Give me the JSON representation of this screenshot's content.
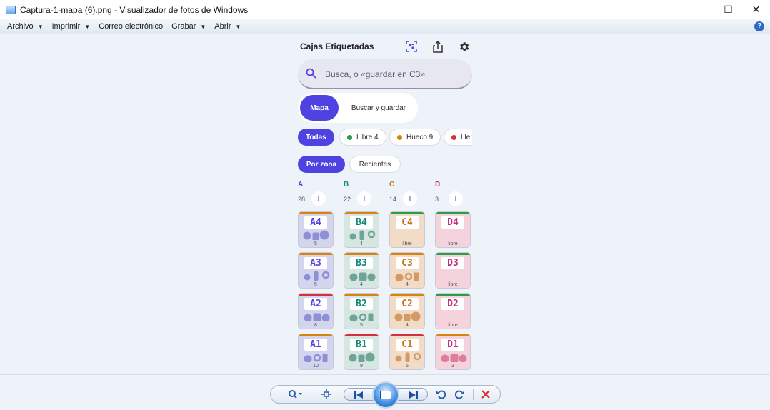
{
  "window": {
    "title": "Captura-1-mapa (6).png - Visualizador de fotos de Windows",
    "minimize": "—",
    "maximize": "☐",
    "close": "✕"
  },
  "menu": [
    "Archivo",
    "Imprimir",
    "Correo electrónico",
    "Grabar",
    "Abrir"
  ],
  "help_label": "?",
  "app": {
    "title": "Cajas Etiquetadas",
    "search_placeholder": "Busca, o «guardar en C3»",
    "segments": [
      "Mapa",
      "Buscar y guardar"
    ],
    "filters": [
      {
        "label": "Todas",
        "selected": true
      },
      {
        "label": "Libre 4",
        "color": "#2e9b45"
      },
      {
        "label": "Hueco 9",
        "color": "#d9820d"
      },
      {
        "label": "Lleno",
        "color": "#d6303a"
      }
    ],
    "view_toggle": [
      "Por zona",
      "Recientes"
    ],
    "zones": [
      {
        "name": "A",
        "count": "28",
        "color": "#4e43e0",
        "tint": "#d3d5ef",
        "ink": "#8e90d6"
      },
      {
        "name": "B",
        "count": "22",
        "color": "#14877a",
        "tint": "#d6e6e1",
        "ink": "#6fa598"
      },
      {
        "name": "C",
        "count": "14",
        "color": "#c8741a",
        "tint": "#f2dcc7",
        "ink": "#d49a63"
      },
      {
        "name": "D",
        "count": "3",
        "color": "#c2317a",
        "tint": "#f4d3dc",
        "ink": "#de7d9c"
      }
    ],
    "rows": [
      [
        {
          "id": "A4",
          "status": "#d9820d",
          "count": "5"
        },
        {
          "id": "B4",
          "status": "#d9820d",
          "count": "4"
        },
        {
          "id": "C4",
          "status": "#2e9b45",
          "count": "libre"
        },
        {
          "id": "D4",
          "status": "#2e9b45",
          "count": "libre"
        }
      ],
      [
        {
          "id": "A3",
          "status": "#d9820d",
          "count": "5"
        },
        {
          "id": "B3",
          "status": "#d9820d",
          "count": "4"
        },
        {
          "id": "C3",
          "status": "#d9820d",
          "count": "4"
        },
        {
          "id": "D3",
          "status": "#2e9b45",
          "count": "libre"
        }
      ],
      [
        {
          "id": "A2",
          "status": "#d6303a",
          "count": "8"
        },
        {
          "id": "B2",
          "status": "#d9820d",
          "count": "5"
        },
        {
          "id": "C2",
          "status": "#d9820d",
          "count": "4"
        },
        {
          "id": "D2",
          "status": "#2e9b45",
          "count": "libre"
        }
      ],
      [
        {
          "id": "A1",
          "status": "#d9820d",
          "count": "10"
        },
        {
          "id": "B1",
          "status": "#d6303a",
          "count": "9"
        },
        {
          "id": "C1",
          "status": "#d6303a",
          "count": "6"
        },
        {
          "id": "D1",
          "status": "#d9820d",
          "count": "3"
        }
      ]
    ],
    "icons": [
      "qr-scan-icon",
      "share-icon",
      "gear-icon",
      "search-icon"
    ]
  },
  "toolbar": {
    "icons": [
      "zoom-icon",
      "actual-size-icon",
      "previous-icon",
      "slideshow-icon",
      "next-icon",
      "rotate-left-icon",
      "rotate-right-icon",
      "delete-icon"
    ]
  }
}
